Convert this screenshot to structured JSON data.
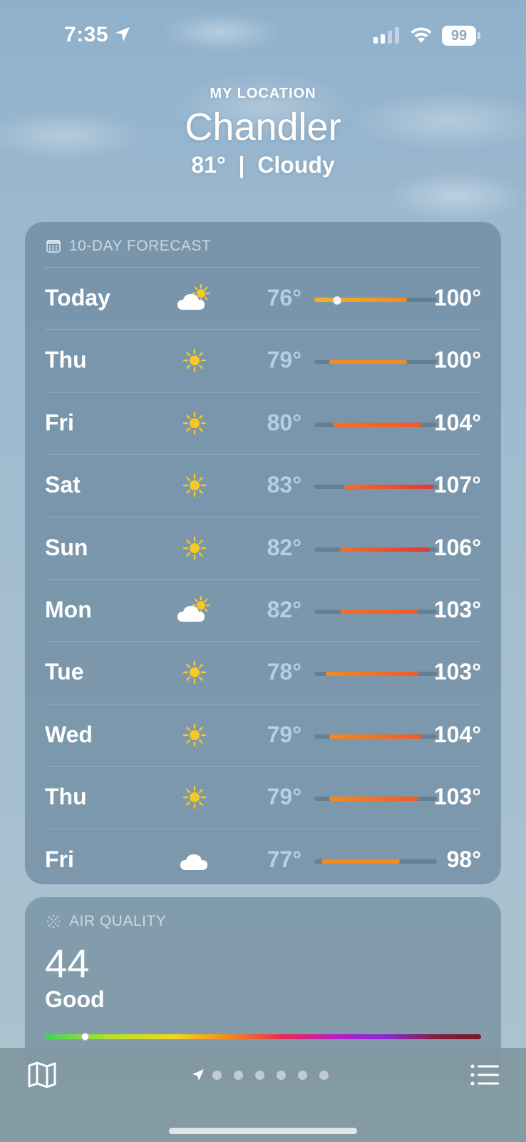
{
  "status_bar": {
    "time": "7:35",
    "battery": "99",
    "icons": [
      "location-arrow-icon",
      "cellular-signal-icon",
      "wifi-icon",
      "battery-icon"
    ]
  },
  "header": {
    "location_label": "MY LOCATION",
    "city": "Chandler",
    "current": "81°  |  Cloudy"
  },
  "forecast": {
    "title": "10-DAY FORECAST",
    "title_icon": "calendar-icon",
    "range_min": 75,
    "range_max": 108,
    "days": [
      {
        "day": "Today",
        "icon": "partly-cloudy-icon",
        "low": "76°",
        "high": "100°",
        "low_val": 76,
        "high_val": 100,
        "current_val": 81,
        "current": true
      },
      {
        "day": "Thu",
        "icon": "sun-icon",
        "low": "79°",
        "high": "100°",
        "low_val": 79,
        "high_val": 100
      },
      {
        "day": "Fri",
        "icon": "sun-icon",
        "low": "80°",
        "high": "104°",
        "low_val": 80,
        "high_val": 104
      },
      {
        "day": "Sat",
        "icon": "sun-icon",
        "low": "83°",
        "high": "107°",
        "low_val": 83,
        "high_val": 107
      },
      {
        "day": "Sun",
        "icon": "sun-icon",
        "low": "82°",
        "high": "106°",
        "low_val": 82,
        "high_val": 106
      },
      {
        "day": "Mon",
        "icon": "partly-cloudy-icon",
        "low": "82°",
        "high": "103°",
        "low_val": 82,
        "high_val": 103
      },
      {
        "day": "Tue",
        "icon": "sun-icon",
        "low": "78°",
        "high": "103°",
        "low_val": 78,
        "high_val": 103
      },
      {
        "day": "Wed",
        "icon": "sun-icon",
        "low": "79°",
        "high": "104°",
        "low_val": 79,
        "high_val": 104
      },
      {
        "day": "Thu",
        "icon": "sun-icon",
        "low": "79°",
        "high": "103°",
        "low_val": 79,
        "high_val": 103
      },
      {
        "day": "Fri",
        "icon": "cloud-icon",
        "low": "77°",
        "high": "98°",
        "low_val": 77,
        "high_val": 98
      }
    ]
  },
  "air_quality": {
    "title": "AIR QUALITY",
    "title_icon": "air-quality-icon",
    "index": "44",
    "label": "Good",
    "scale_fraction": 0.09
  },
  "bottom_bar": {
    "page_count": 6,
    "icons": [
      "map-icon",
      "location-arrow-icon",
      "list-icon"
    ]
  },
  "colors": {
    "sun": "#f7c81e",
    "bar_orange": "#f58a1f",
    "bar_red": "#e0383a",
    "bar_yellow": "#f3b22a"
  }
}
